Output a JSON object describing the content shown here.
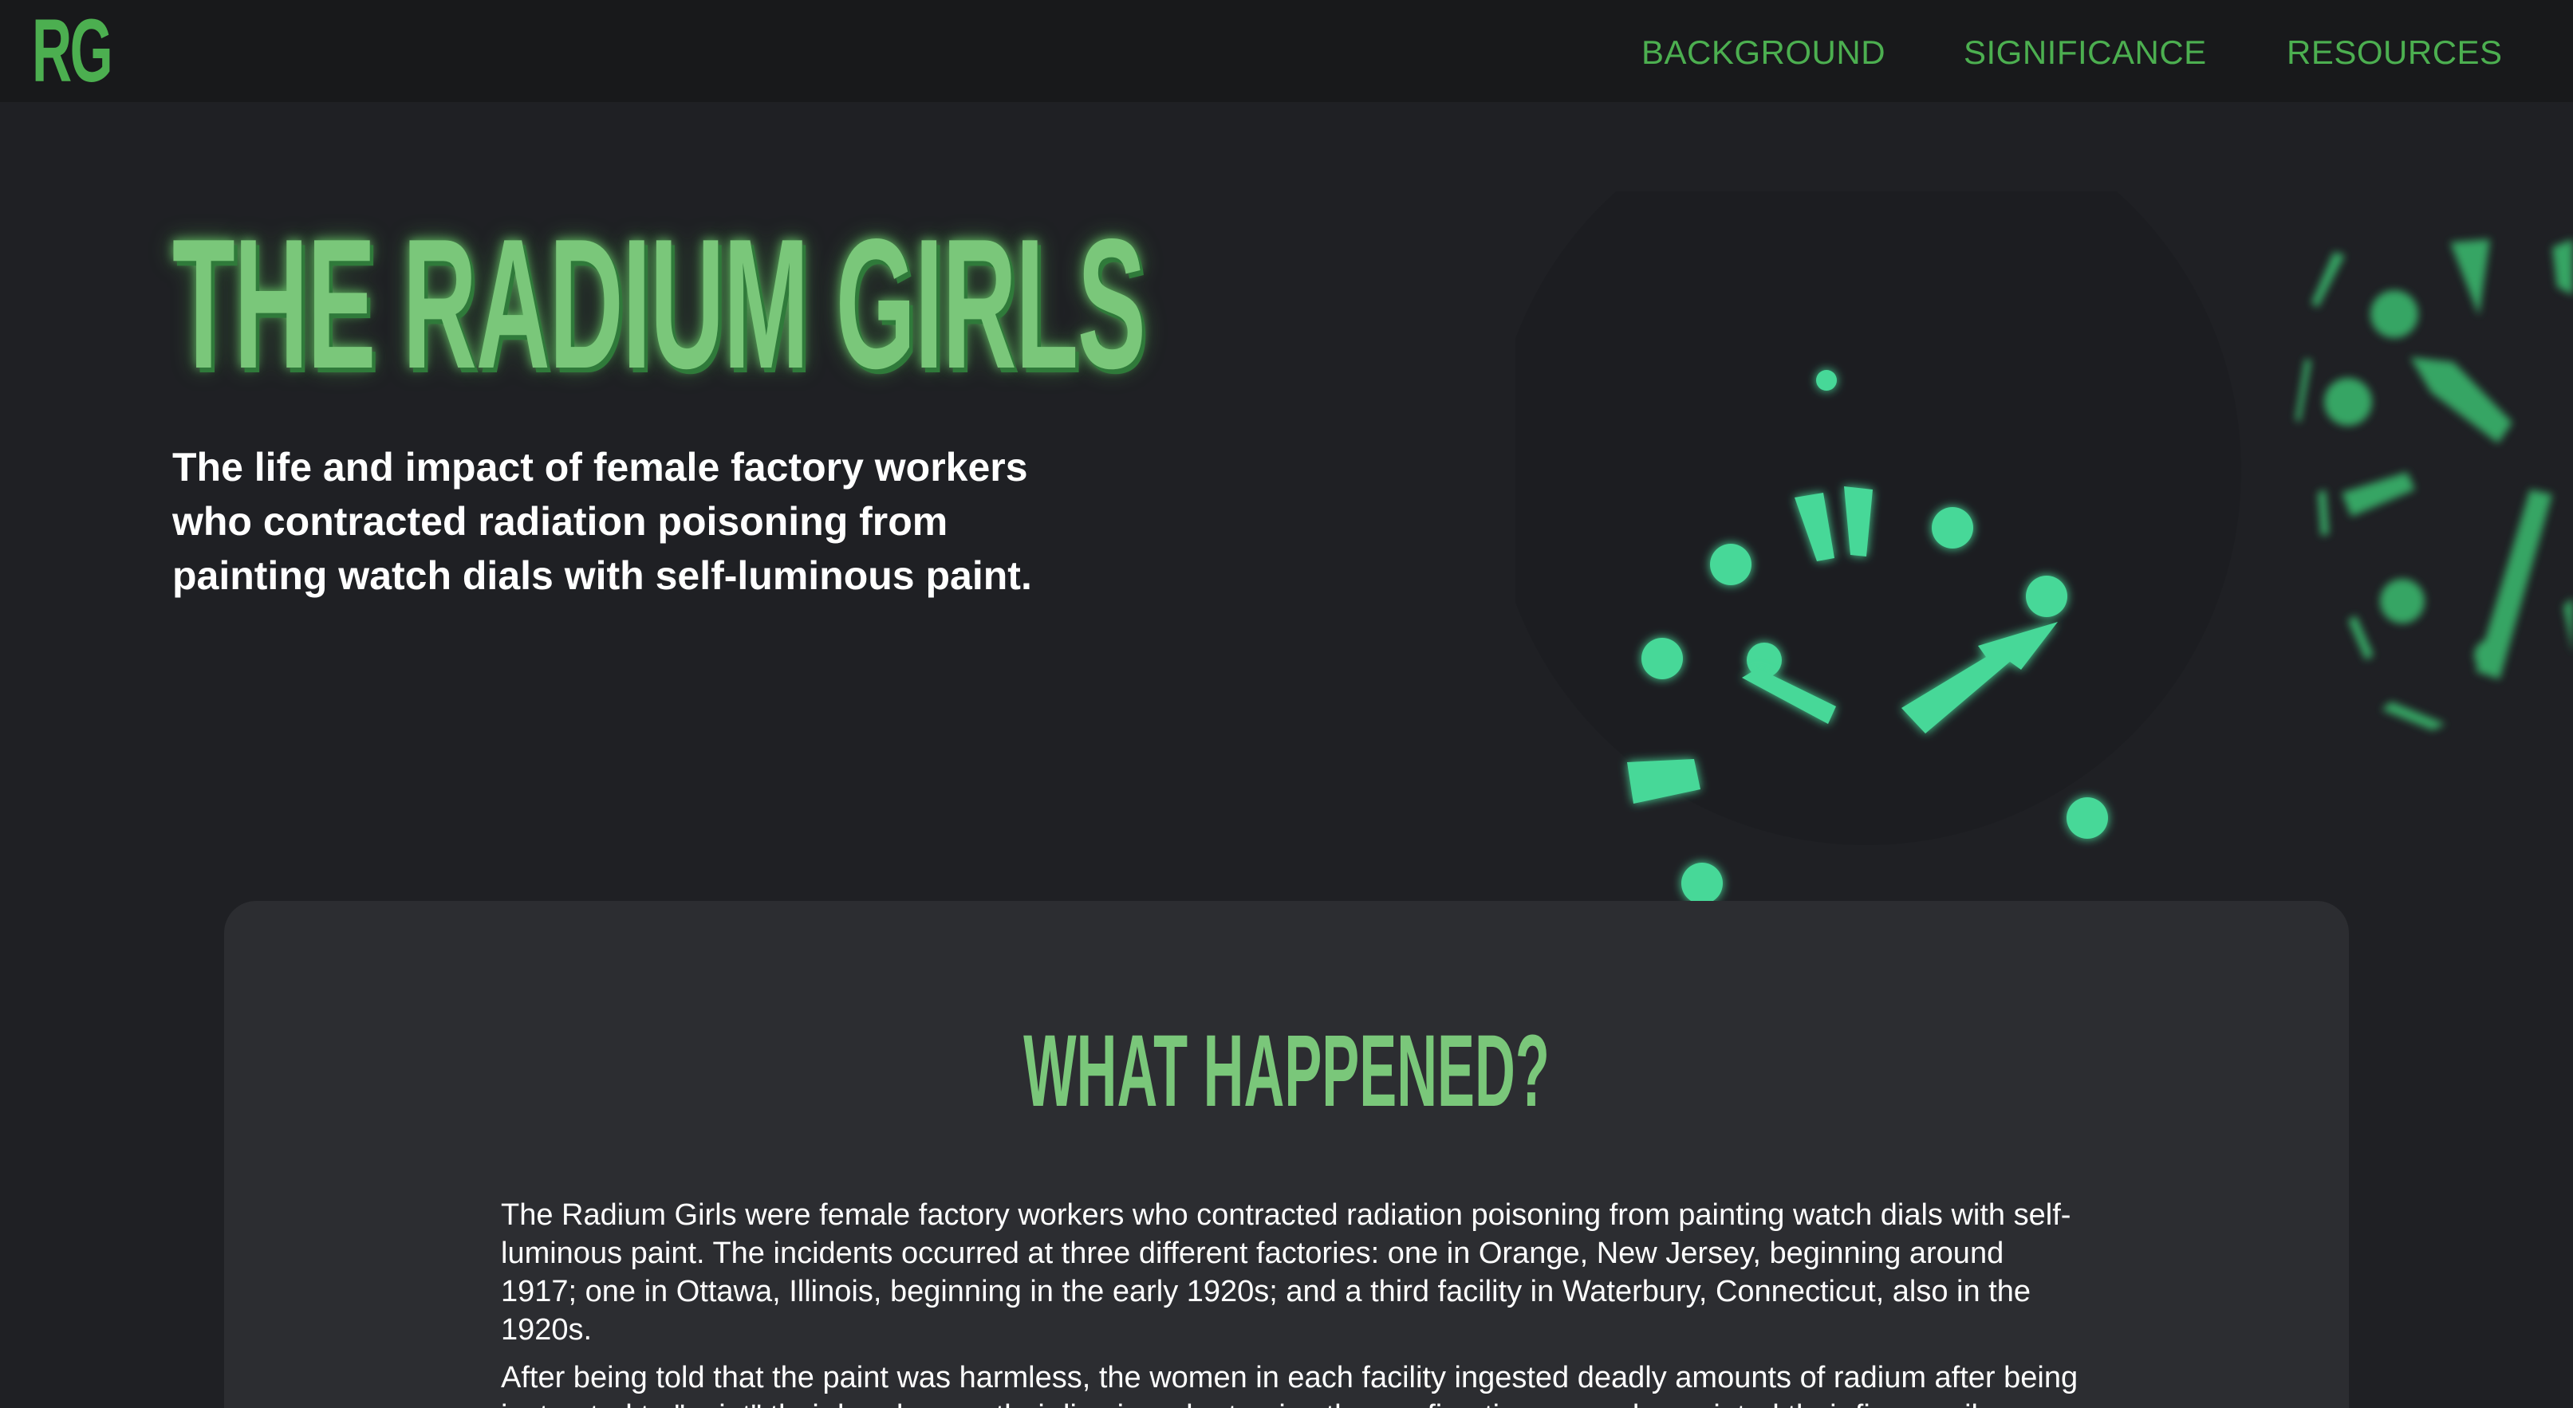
{
  "nav": {
    "logo": "RG",
    "links": [
      "BACKGROUND",
      "SIGNIFICANCE",
      "RESOURCES"
    ]
  },
  "hero": {
    "title": "THE RADIUM GIRLS",
    "subtitle": "The life and impact of female factory workers who contracted radiation poisoning from painting watch dials with self-luminous paint."
  },
  "section": {
    "heading": "WHAT HAPPENED?",
    "paragraphs": [
      "The Radium Girls were female factory workers who contracted radiation poisoning from painting watch dials with self-luminous paint. The incidents occurred at three different factories: one in Orange, New Jersey, beginning around 1917; one in Ottawa, Illinois, beginning in the early 1920s; and a third facility in Waterbury, Connecticut, also in the 1920s.",
      "After being told that the paint was harmless, the women in each facility ingested deadly amounts of radium after being instructed to \"point\" their brushes on their lips in order to give them a fine tip; some also painted their fingernails, faces"
    ]
  },
  "colors": {
    "accent_green": "#4caf50",
    "title_green": "#7ac77a",
    "glow_teal": "#46d898",
    "background": "#1f2024",
    "navbar": "#18191b",
    "card": "#2c2d31"
  },
  "icons": {
    "hero_art": "glowing-watch-dial-illustration"
  }
}
